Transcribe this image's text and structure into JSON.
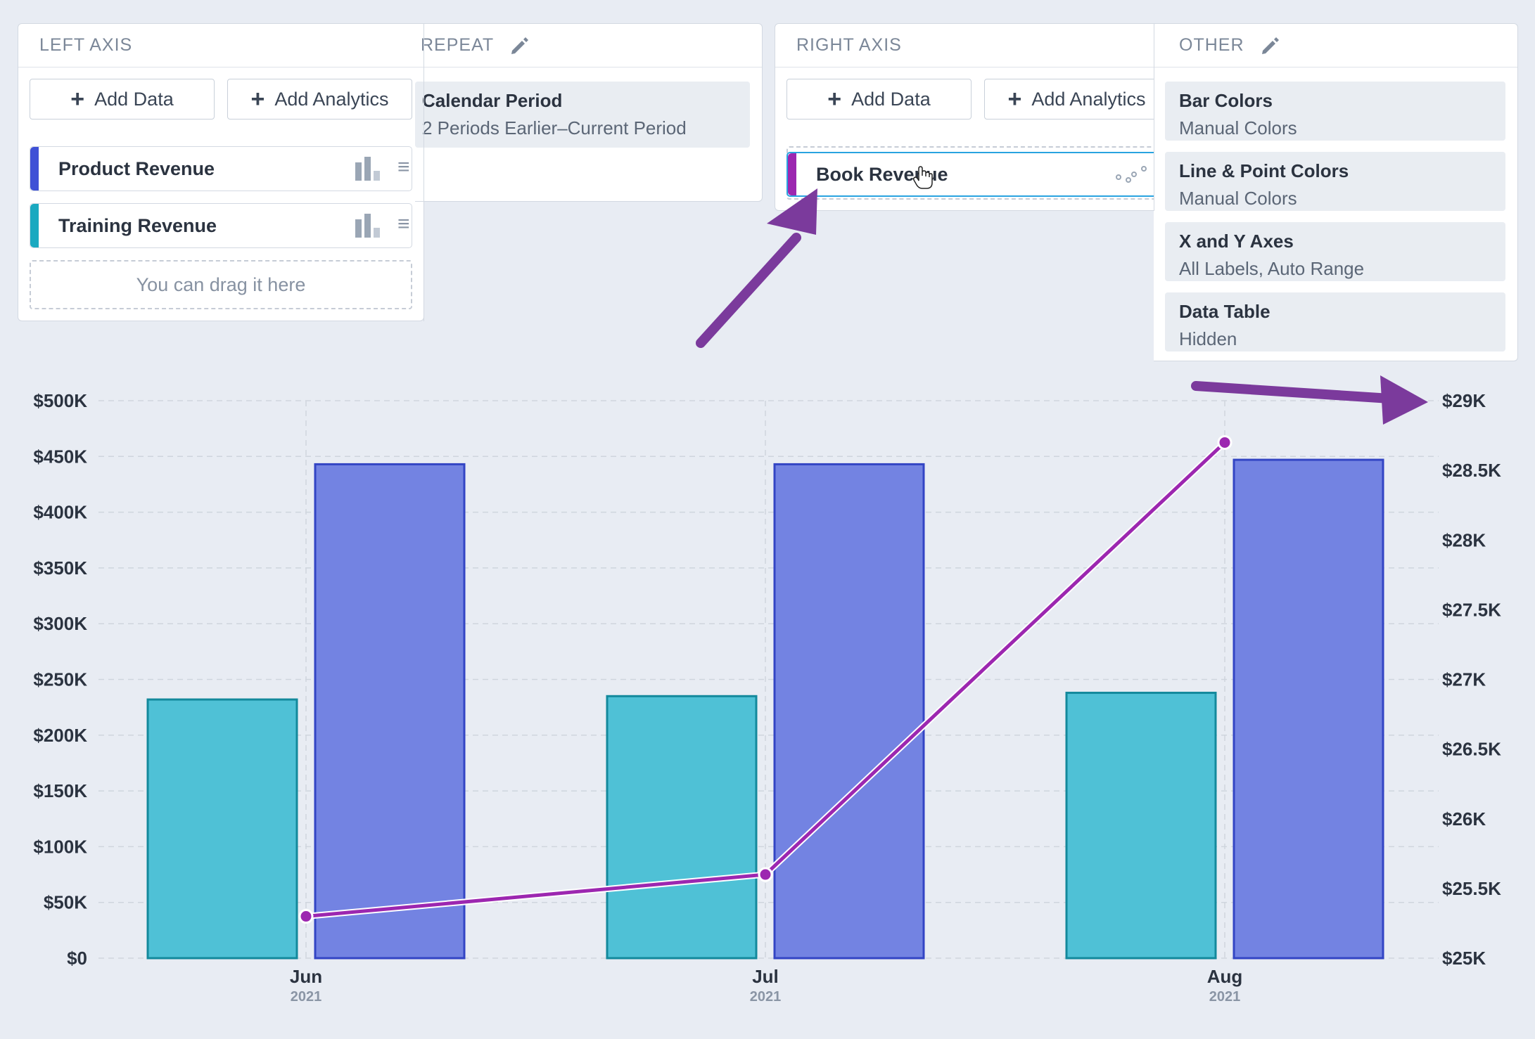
{
  "left_axis": {
    "header": "LEFT AXIS",
    "add_data": "Add Data",
    "add_analytics": "Add Analytics",
    "series": [
      {
        "label": "Product Revenue",
        "color": "#3f51d6",
        "icon": "bar-chart-icon"
      },
      {
        "label": "Training Revenue",
        "color": "#1aa9c0",
        "icon": "bar-chart-icon"
      }
    ],
    "drop_hint": "You can drag it here"
  },
  "repeat": {
    "header": "REPEAT",
    "item_title": "Calendar Period",
    "item_sub": "2 Periods Earlier–Current Period"
  },
  "right_axis": {
    "header": "RIGHT AXIS",
    "add_data": "Add Data",
    "add_analytics": "Add Analytics",
    "series": [
      {
        "label": "Book Revenue",
        "color": "#9c27b0",
        "icon": "line-chart-icon"
      }
    ]
  },
  "other": {
    "header": "OTHER",
    "items": [
      {
        "title": "Bar Colors",
        "sub": "Manual Colors"
      },
      {
        "title": "Line & Point Colors",
        "sub": "Manual Colors"
      },
      {
        "title": "X and Y Axes",
        "sub": "All Labels, Auto Range"
      },
      {
        "title": "Data Table",
        "sub": "Hidden"
      }
    ]
  },
  "colors": {
    "product_bar": "#7383e2",
    "product_bar_border": "#3345c4",
    "training_bar": "#4fc1d6",
    "training_bar_border": "#13899c",
    "line": "#9c27b0",
    "annotation_arrow": "#7b3a9c"
  },
  "chart_data": {
    "type": "bar",
    "categories": [
      "Jun",
      "Jul",
      "Aug"
    ],
    "category_years": [
      "2021",
      "2021",
      "2021"
    ],
    "series": [
      {
        "name": "Training Revenue",
        "axis": "left",
        "type": "bar",
        "values": [
          232000,
          235000,
          238000
        ]
      },
      {
        "name": "Product Revenue",
        "axis": "left",
        "type": "bar",
        "values": [
          443000,
          443000,
          447000
        ]
      },
      {
        "name": "Book Revenue",
        "axis": "right",
        "type": "line",
        "values": [
          25300,
          25600,
          28700
        ]
      }
    ],
    "left_axis": {
      "range": [
        0,
        500000
      ],
      "ticks": [
        "$0",
        "$50K",
        "$100K",
        "$150K",
        "$200K",
        "$250K",
        "$300K",
        "$350K",
        "$400K",
        "$450K",
        "$500K"
      ]
    },
    "right_axis": {
      "range": [
        25000,
        29000
      ],
      "ticks": [
        "$25K",
        "$25.5K",
        "$26K",
        "$26.5K",
        "$27K",
        "$27.5K",
        "$28K",
        "$28.5K",
        "$29K"
      ]
    },
    "grid": true
  }
}
